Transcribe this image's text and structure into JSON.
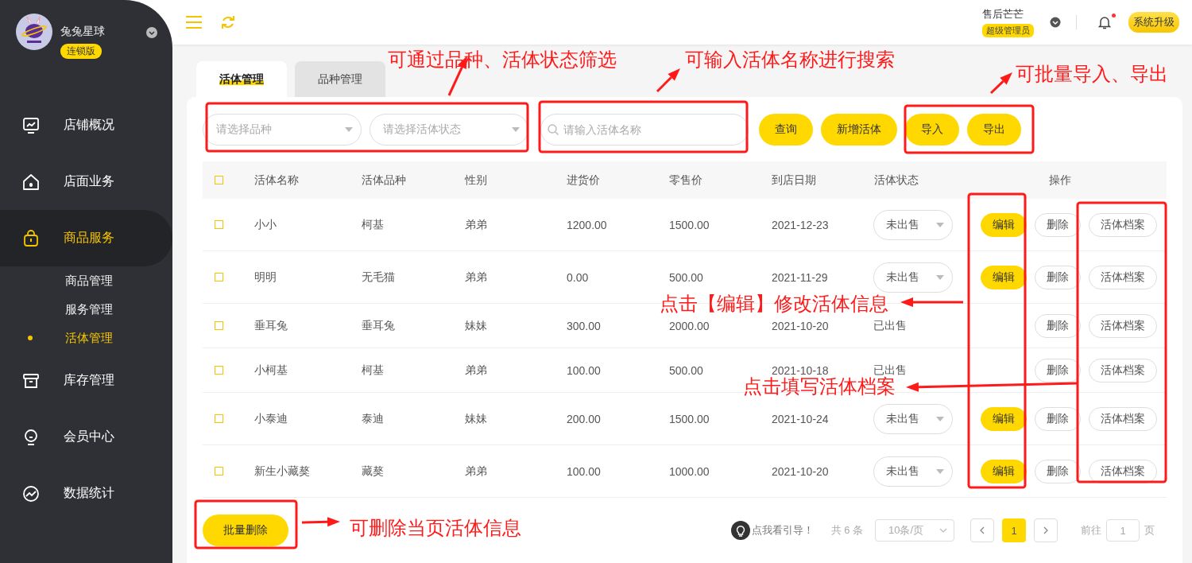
{
  "sidebar": {
    "store_name": "兔兔星球",
    "edition": "连锁版",
    "nav": [
      {
        "label": "店铺概况",
        "selected": false
      },
      {
        "label": "店面业务",
        "selected": false
      },
      {
        "label": "商品服务",
        "selected": true,
        "children": [
          {
            "label": "商品管理",
            "selected": false
          },
          {
            "label": "服务管理",
            "selected": false
          },
          {
            "label": "活体管理",
            "selected": true
          }
        ]
      },
      {
        "label": "库存管理",
        "selected": false
      },
      {
        "label": "会员中心",
        "selected": false
      },
      {
        "label": "数据统计",
        "selected": false
      }
    ]
  },
  "header": {
    "user_name": "售后芒芒",
    "role": "超级管理员",
    "notifications_unread": true,
    "upgrade_button": "系统升级"
  },
  "tabs": [
    {
      "label": "活体管理",
      "selected": true
    },
    {
      "label": "品种管理",
      "selected": false
    }
  ],
  "filters": {
    "breed_select": {
      "placeholder": "请选择品种"
    },
    "status_select": {
      "placeholder": "请选择活体状态"
    },
    "search": {
      "placeholder": "请输入活体名称"
    },
    "buttons": [
      "查询",
      "新增活体",
      "导入",
      "导出"
    ]
  },
  "table": {
    "select_all_checked": false,
    "columns": [
      "活体名称",
      "活体品种",
      "性别",
      "进货价",
      "零售价",
      "到店日期",
      "活体状态",
      "操作"
    ],
    "rows": [
      {
        "checked": false,
        "cells": [
          "小小",
          "柯基",
          "弟弟",
          "1200.00",
          "1500.00",
          "2021-12-23"
        ],
        "status": {
          "kind": "select",
          "text": "未出售"
        },
        "actions": [
          {
            "label": "编辑",
            "kind": "primary"
          },
          {
            "label": "删除",
            "kind": "plain"
          },
          {
            "label": "活体档案",
            "kind": "plain"
          }
        ]
      },
      {
        "checked": false,
        "cells": [
          "明明",
          "无毛猫",
          "弟弟",
          "0.00",
          "500.00",
          "2021-11-29"
        ],
        "status": {
          "kind": "select",
          "text": "未出售"
        },
        "actions": [
          {
            "label": "编辑",
            "kind": "primary"
          },
          {
            "label": "删除",
            "kind": "plain"
          },
          {
            "label": "活体档案",
            "kind": "plain"
          }
        ]
      },
      {
        "checked": false,
        "cells": [
          "垂耳兔",
          "垂耳兔",
          "妹妹",
          "300.00",
          "2000.00",
          "2021-10-20"
        ],
        "status": {
          "kind": "text",
          "text": "已出售"
        },
        "actions": [
          {
            "label": "删除",
            "kind": "plain"
          },
          {
            "label": "活体档案",
            "kind": "plain"
          }
        ]
      },
      {
        "checked": false,
        "cells": [
          "小柯基",
          "柯基",
          "弟弟",
          "100.00",
          "500.00",
          "2021-10-18"
        ],
        "status": {
          "kind": "text",
          "text": "已出售"
        },
        "actions": [
          {
            "label": "删除",
            "kind": "plain"
          },
          {
            "label": "活体档案",
            "kind": "plain"
          }
        ]
      },
      {
        "checked": false,
        "cells": [
          "小泰迪",
          "泰迪",
          "妹妹",
          "200.00",
          "1500.00",
          "2021-10-24"
        ],
        "status": {
          "kind": "select",
          "text": "未出售"
        },
        "actions": [
          {
            "label": "编辑",
            "kind": "primary"
          },
          {
            "label": "删除",
            "kind": "plain"
          },
          {
            "label": "活体档案",
            "kind": "plain"
          }
        ]
      },
      {
        "checked": false,
        "cells": [
          "新生小藏獒",
          "藏獒",
          "弟弟",
          "100.00",
          "1000.00",
          "2021-10-20"
        ],
        "status": {
          "kind": "select",
          "text": "未出售"
        },
        "actions": [
          {
            "label": "编辑",
            "kind": "primary"
          },
          {
            "label": "删除",
            "kind": "plain"
          },
          {
            "label": "活体档案",
            "kind": "plain"
          }
        ]
      }
    ]
  },
  "batch_delete_button": "批量删除",
  "pagination": {
    "guide_link": "点我看引导！",
    "total": "共 6 条",
    "page_size": "10条/页",
    "pages": [
      {
        "label": "1",
        "selected": true
      }
    ],
    "goto_label": "前往",
    "goto_value": "1",
    "page_suffix": "页"
  },
  "annotations": [
    {
      "text": "可通过品种、活体状态筛选"
    },
    {
      "text": "可输入活体名称进行搜索"
    },
    {
      "text": "可批量导入、导出"
    },
    {
      "text": "点击【编辑】修改活体信息"
    },
    {
      "text": "点击填写活体档案"
    },
    {
      "text": "可删除当页活体信息"
    }
  ]
}
